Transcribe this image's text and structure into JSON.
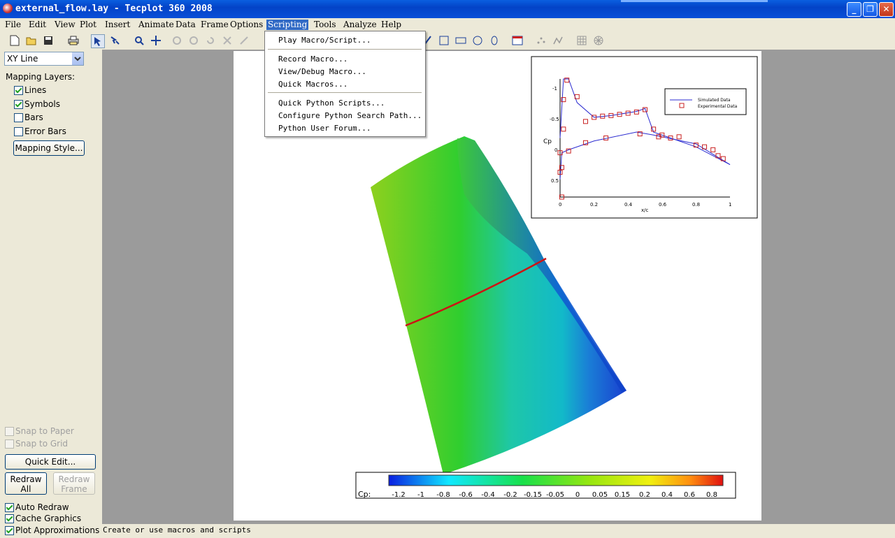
{
  "window": {
    "title": "external_flow.lay - Tecplot 360 2008"
  },
  "menu": [
    "File",
    "Edit",
    "View",
    "Plot",
    "Insert",
    "Animate",
    "Data",
    "Frame",
    "Options",
    "Scripting",
    "Tools",
    "Analyze",
    "Help"
  ],
  "scripting_menu": {
    "group1": [
      "Play Macro/Script..."
    ],
    "group2": [
      "Record Macro...",
      "View/Debug Macro...",
      "Quick Macros..."
    ],
    "group3": [
      "Quick Python Scripts...",
      "Configure Python Search Path...",
      "Python User Forum..."
    ]
  },
  "sidebar": {
    "plot_type": "XY Line",
    "mapping_layers_label": "Mapping Layers:",
    "layers": [
      {
        "label": "Lines",
        "checked": true
      },
      {
        "label": "Symbols",
        "checked": true
      },
      {
        "label": "Bars",
        "checked": false
      },
      {
        "label": "Error Bars",
        "checked": false
      }
    ],
    "mapping_style_button": "Mapping Style...",
    "snap_to_paper": "Snap to Paper",
    "snap_to_grid": "Snap to Grid",
    "quick_edit_button": "Quick Edit...",
    "redraw_all_line1": "Redraw",
    "redraw_all_line2": "All",
    "redraw_frame_line1": "Redraw",
    "redraw_frame_line2": "Frame",
    "auto_redraw": "Auto Redraw",
    "cache_graphics": "Cache Graphics",
    "plot_approximations": "Plot Approximations"
  },
  "status": {
    "text": "Create or use macros and scripts"
  },
  "colorbar": {
    "label": "Cp:",
    "ticks": [
      "-1.2",
      "-1",
      "-0.8",
      "-0.6",
      "-0.4",
      "-0.2",
      "-0.15",
      "-0.05",
      "0",
      "0.05",
      "0.15",
      "0.2",
      "0.4",
      "0.6",
      "0.8"
    ]
  },
  "inset": {
    "ylabel": "Cp",
    "xlabel": "x/c",
    "yticks": [
      "-1",
      "-0.5",
      "0",
      "0.5"
    ],
    "xticks": [
      "0",
      "0.2",
      "0.4",
      "0.6",
      "0.8",
      "1"
    ],
    "legend": [
      "Simulated Data",
      "Experimental Data"
    ],
    "colors": {
      "line": "#2b2bd0",
      "marker": "#c82020"
    }
  },
  "chart_data": {
    "type": "line",
    "xlabel": "x/c",
    "ylabel": "Cp",
    "xlim": [
      0,
      1
    ],
    "ylim": [
      0.8,
      -1.2
    ],
    "series": [
      {
        "name": "Simulated Data",
        "kind": "line",
        "upper": [
          [
            0,
            -0.2
          ],
          [
            0.02,
            -1.2
          ],
          [
            0.05,
            -1.2
          ],
          [
            0.1,
            -0.8
          ],
          [
            0.2,
            -0.55
          ],
          [
            0.3,
            -0.58
          ],
          [
            0.45,
            -0.65
          ],
          [
            0.5,
            -0.7
          ],
          [
            0.55,
            -0.3
          ],
          [
            0.6,
            -0.25
          ],
          [
            0.8,
            -0.05
          ],
          [
            1,
            0.25
          ]
        ],
        "lower": [
          [
            0,
            0.5
          ],
          [
            0.01,
            0.05
          ],
          [
            0.05,
            0
          ],
          [
            0.2,
            -0.15
          ],
          [
            0.45,
            -0.3
          ],
          [
            0.55,
            -0.25
          ],
          [
            0.8,
            -0.1
          ],
          [
            1,
            0.25
          ]
        ]
      },
      {
        "name": "Experimental Data",
        "kind": "markers",
        "points": [
          [
            0.01,
            0.8
          ],
          [
            0.0,
            0.38
          ],
          [
            0.01,
            0.3
          ],
          [
            0.02,
            -0.35
          ],
          [
            0.02,
            -0.85
          ],
          [
            0.04,
            -1.18
          ],
          [
            0.1,
            -0.9
          ],
          [
            0.15,
            -0.48
          ],
          [
            0.2,
            -0.55
          ],
          [
            0.25,
            -0.57
          ],
          [
            0.3,
            -0.58
          ],
          [
            0.35,
            -0.6
          ],
          [
            0.4,
            -0.62
          ],
          [
            0.45,
            -0.64
          ],
          [
            0.5,
            -0.68
          ],
          [
            0.55,
            -0.35
          ],
          [
            0.6,
            -0.25
          ],
          [
            0.65,
            -0.2
          ],
          [
            0.7,
            -0.22
          ],
          [
            0.8,
            -0.08
          ],
          [
            0.85,
            -0.05
          ],
          [
            0.9,
            0.0
          ],
          [
            0.93,
            0.1
          ],
          [
            0.96,
            0.15
          ],
          [
            0.0,
            0.05
          ],
          [
            0.05,
            0.02
          ],
          [
            0.15,
            -0.12
          ],
          [
            0.27,
            -0.2
          ],
          [
            0.47,
            -0.27
          ],
          [
            0.58,
            -0.22
          ]
        ]
      }
    ]
  }
}
